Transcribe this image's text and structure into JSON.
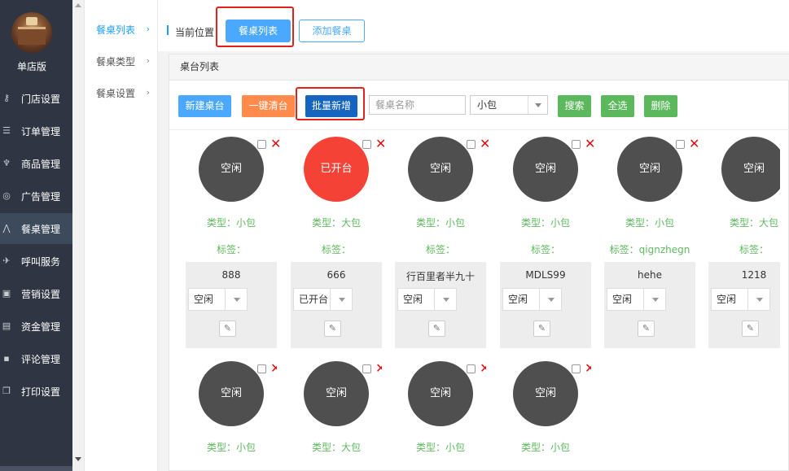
{
  "sidebar": {
    "shop_label": "单店版",
    "items": [
      {
        "label": "门店设置",
        "icon": "key-icon"
      },
      {
        "label": "订单管理",
        "icon": "list-icon"
      },
      {
        "label": "商品管理",
        "icon": "trophy-icon"
      },
      {
        "label": "广告管理",
        "icon": "lifebuoy-icon"
      },
      {
        "label": "餐桌管理",
        "icon": "road-icon"
      },
      {
        "label": "呼叫服务",
        "icon": "plane-icon"
      },
      {
        "label": "营销设置",
        "icon": "gift-icon"
      },
      {
        "label": "资金管理",
        "icon": "card-icon"
      },
      {
        "label": "评论管理",
        "icon": "comment-icon"
      },
      {
        "label": "打印设置",
        "icon": "copy-icon"
      }
    ],
    "active_index": 4
  },
  "submenu": {
    "items": [
      {
        "label": "餐桌列表"
      },
      {
        "label": "餐桌类型"
      },
      {
        "label": "餐桌设置"
      }
    ]
  },
  "breadcrumb": {
    "position_label": "当前位置",
    "tab_list": "餐桌列表",
    "tab_add": "添加餐桌"
  },
  "panel": {
    "title": "桌台列表"
  },
  "toolbar": {
    "new_table": "新建桌台",
    "clear_all": "一键清台",
    "batch_add": "批量新增",
    "name_placeholder": "餐桌名称",
    "type_select": "小包",
    "search": "搜索",
    "select_all": "全选",
    "delete": "删除"
  },
  "colors": {
    "primary": "#1e9fff",
    "orange": "#ff8040",
    "navy": "#1565c0",
    "green": "#5cb85c",
    "red": "#f44336",
    "idle": "#4f4f4f"
  },
  "tables": [
    {
      "status": "空闲",
      "type": "类型：小包",
      "tags": "标签：",
      "name": "888",
      "state": "空闲"
    },
    {
      "status": "已开台",
      "type": "类型：大包",
      "tags": "标签：",
      "name": "666",
      "state": "已开台"
    },
    {
      "status": "空闲",
      "type": "类型：小包",
      "tags": "标签：",
      "name": "行百里者半九十",
      "state": "空闲"
    },
    {
      "status": "空闲",
      "type": "类型：小包",
      "tags": "标签：",
      "name": "MDLS99",
      "state": "空闲"
    },
    {
      "status": "空闲",
      "type": "类型：小包",
      "tags": "标签：qignzhegn",
      "name": "hehe",
      "state": "空闲"
    },
    {
      "status": "空闲",
      "type": "类型：大包",
      "tags": "标签：",
      "name": "1218",
      "state": "空闲"
    },
    {
      "status": "空闲",
      "type": "类型：小包",
      "tags": "",
      "name": "",
      "state": ""
    },
    {
      "status": "空闲",
      "type": "类型：大包",
      "tags": "",
      "name": "",
      "state": ""
    },
    {
      "status": "空闲",
      "type": "类型：小包",
      "tags": "",
      "name": "",
      "state": ""
    },
    {
      "status": "空闲",
      "type": "类型：小包",
      "tags": "",
      "name": "",
      "state": ""
    }
  ]
}
